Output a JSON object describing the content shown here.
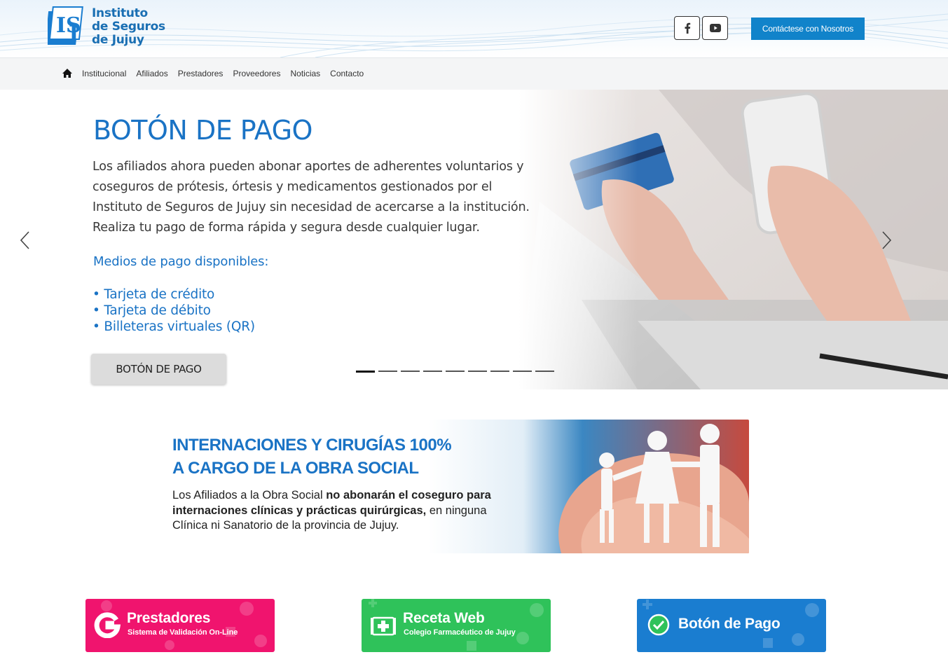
{
  "header": {
    "logo_text_line1": "Instituto",
    "logo_text_line2": "de Seguros",
    "logo_text_line3": "de Jujuy",
    "contact_button": "Contáctese con Nosotros"
  },
  "nav": {
    "items": [
      "Institucional",
      "Afiliados",
      "Prestadores",
      "Proveedores",
      "Noticias",
      "Contacto"
    ]
  },
  "hero": {
    "title": "BOTÓN DE PAGO",
    "body": [
      "Los afiliados ahora pueden abonar aportes de adherentes voluntarios y",
      "coseguros de prótesis, órtesis y medicamentos gestionados por el",
      "Instituto de Seguros de Jujuy sin necesidad de acercarse a la institución.",
      "Realiza tu pago de forma rápida y segura desde cualquier lugar."
    ],
    "subtitle": "Medios de pago disponibles:",
    "list": [
      "• Tarjeta de crédito",
      "• Tarjeta de débito",
      "• Billeteras virtuales (QR)"
    ],
    "button": "BOTÓN DE PAGO",
    "slide_count": 9,
    "active_slide": 1
  },
  "banner": {
    "title_line1": "INTERNACIONES Y CIRUGÍAS 100%",
    "title_line2": "A CARGO DE LA OBRA SOCIAL",
    "text_part1": "Los Afiliados a la Obra Social ",
    "text_bold": "no abonarán el coseguro para internaciones clínicas y prácticas quirúrgicas,",
    "text_part2": " en ninguna Clínica ni Sanatorio de la provincia de Jujuy."
  },
  "cards": [
    {
      "title": "Prestadores",
      "subtitle": "Sistema de Validación On-Line",
      "color": "#f0146e"
    },
    {
      "title": "Receta Web",
      "subtitle": "Colegio Farmacéutico de Jujuy",
      "color": "#2fc25a"
    },
    {
      "title": "Botón de Pago",
      "subtitle": "",
      "color": "#1a7dd0"
    }
  ],
  "colors": {
    "brand_blue": "#1a73c5",
    "contact_button": "#1183ca"
  }
}
